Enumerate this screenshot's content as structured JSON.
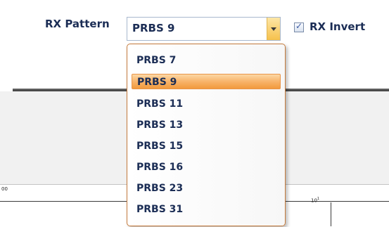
{
  "rx_pattern": {
    "label": "RX Pattern",
    "selected": "PRBS 9",
    "options": [
      "PRBS 7",
      "PRBS 9",
      "PRBS 11",
      "PRBS 13",
      "PRBS 15",
      "PRBS 16",
      "PRBS 23",
      "PRBS 31"
    ]
  },
  "rx_invert": {
    "label": "RX Invert",
    "checked": true,
    "check_glyph": "✓"
  },
  "chart": {
    "left_tick": "00",
    "right_tick_base": "10",
    "right_tick_exp": "1"
  },
  "colors": {
    "highlight": "#f8b36a",
    "dropdown_border": "#c47a3c",
    "combo_arrow": "#f6c14c"
  }
}
